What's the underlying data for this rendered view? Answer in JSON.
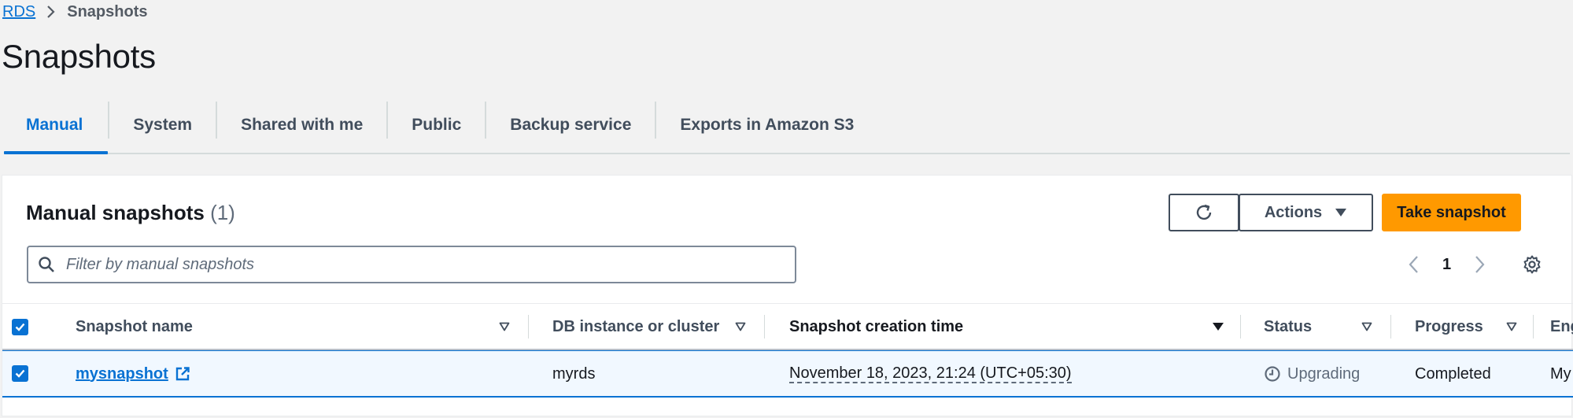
{
  "breadcrumb": {
    "root": "RDS",
    "current": "Snapshots"
  },
  "page": {
    "title": "Snapshots"
  },
  "tabs": [
    {
      "label": "Manual",
      "active": true
    },
    {
      "label": "System",
      "active": false
    },
    {
      "label": "Shared with me",
      "active": false
    },
    {
      "label": "Public",
      "active": false
    },
    {
      "label": "Backup service",
      "active": false
    },
    {
      "label": "Exports in Amazon S3",
      "active": false
    }
  ],
  "panel": {
    "title": "Manual snapshots",
    "count": "(1)",
    "actions_label": "Actions",
    "take_snapshot_label": "Take snapshot",
    "filter_placeholder": "Filter by manual snapshots",
    "page_number": "1"
  },
  "table": {
    "columns": {
      "name": "Snapshot name",
      "db": "DB instance or cluster",
      "time": "Snapshot creation time",
      "status": "Status",
      "progress": "Progress",
      "engine": "Eng"
    },
    "rows": [
      {
        "name": "mysnapshot",
        "db": "myrds",
        "time": "November 18, 2023, 21:24 (UTC+05:30)",
        "status": "Upgrading",
        "progress": "Completed",
        "engine": "My"
      }
    ]
  },
  "colors": {
    "accent": "#0972d3",
    "primary_button": "#ff9900",
    "background": "#f2f2f2"
  },
  "icons": [
    "chevron-right-icon",
    "refresh-icon",
    "caret-down-icon",
    "search-icon",
    "chevron-left-icon",
    "gear-icon",
    "sort-icon",
    "sort-desc-icon",
    "external-link-icon",
    "clock-icon",
    "checkbox-checked-icon"
  ]
}
